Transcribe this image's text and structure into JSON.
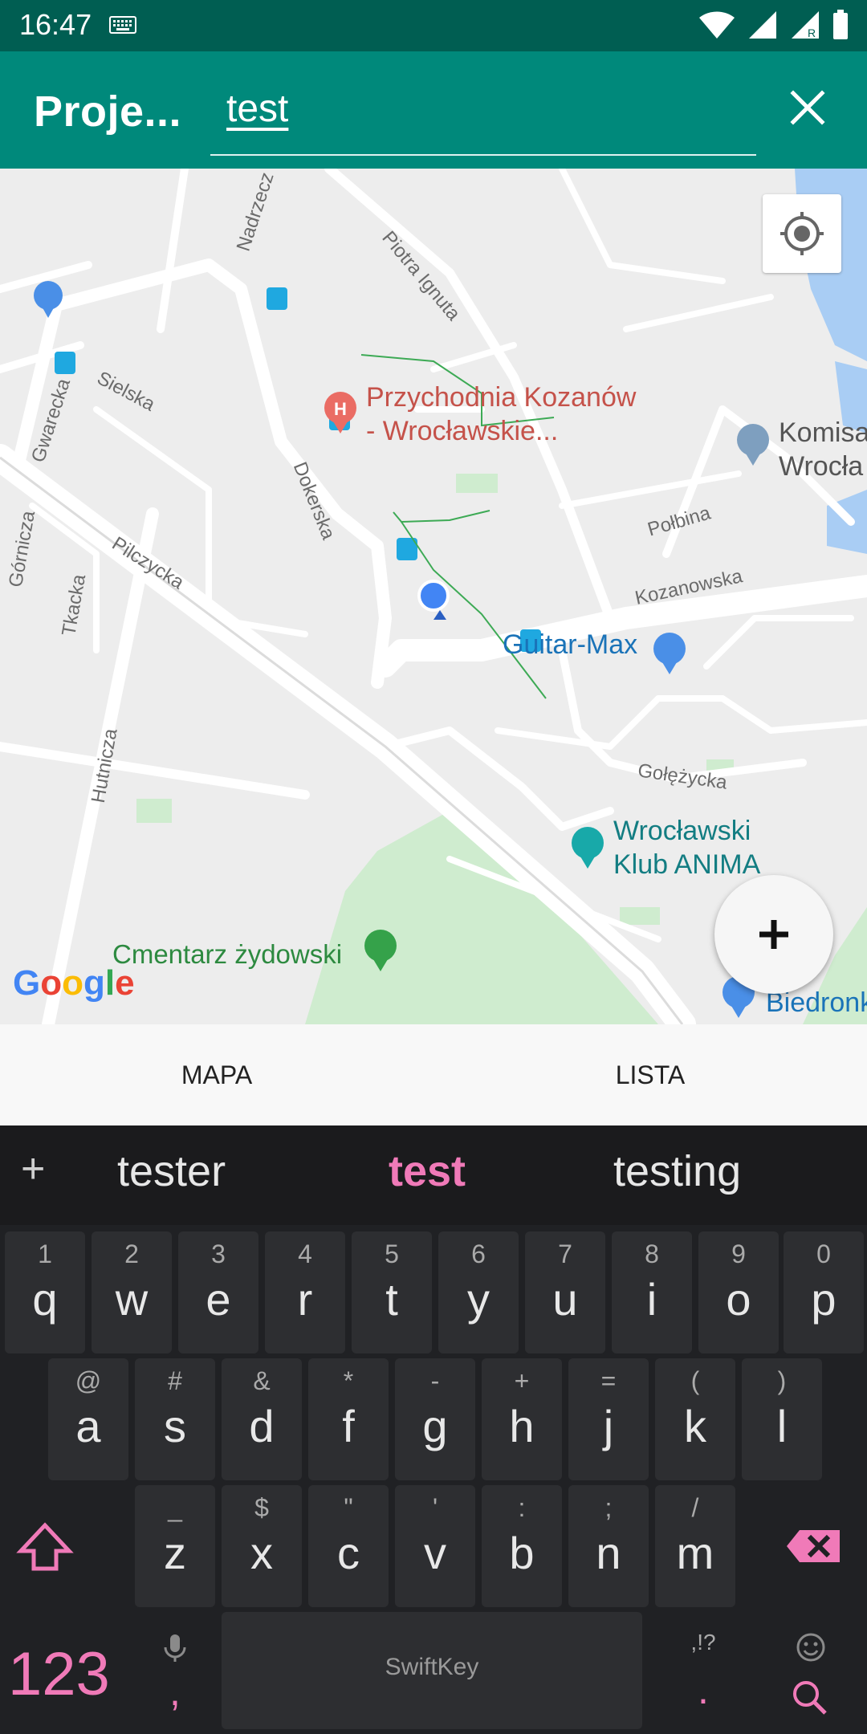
{
  "status_bar": {
    "time": "16:47"
  },
  "app_bar": {
    "title": "Proje...",
    "search_value": "test"
  },
  "map": {
    "poi": {
      "clinic": "Przychodnia Kozanów\n- Wrocławskie...",
      "clinic_line1": "Przychodnia Kozanów",
      "clinic_line2": "- Wrocławskie...",
      "komis_line1": "Komisa",
      "komis_line2": "Wrocła",
      "guitar": "Guitar-Max",
      "club_line1": "Wrocławski",
      "club_line2": "Klub ANIMA",
      "cemetery": "Cmentarz żydowski",
      "biedronka": "Biedronk"
    },
    "streets": [
      "Nadrzecz",
      "Piotra Ignuta",
      "Sielska",
      "Gwarecka",
      "Dokerska",
      "Połbina",
      "Kozanowska",
      "Górnicza",
      "Tkacka",
      "Pilczycka",
      "Hutnicza",
      "Gołężycka"
    ],
    "google": "Google"
  },
  "tabs": {
    "map": "MAPA",
    "list": "LISTA"
  },
  "keyboard": {
    "suggestions": [
      "tester",
      "test",
      "testing"
    ],
    "row1": [
      {
        "alt": "1",
        "key": "q"
      },
      {
        "alt": "2",
        "key": "w"
      },
      {
        "alt": "3",
        "key": "e"
      },
      {
        "alt": "4",
        "key": "r"
      },
      {
        "alt": "5",
        "key": "t"
      },
      {
        "alt": "6",
        "key": "y"
      },
      {
        "alt": "7",
        "key": "u"
      },
      {
        "alt": "8",
        "key": "i"
      },
      {
        "alt": "9",
        "key": "o"
      },
      {
        "alt": "0",
        "key": "p"
      }
    ],
    "row2": [
      {
        "alt": "@",
        "key": "a"
      },
      {
        "alt": "#",
        "key": "s"
      },
      {
        "alt": "&",
        "key": "d"
      },
      {
        "alt": "*",
        "key": "f"
      },
      {
        "alt": "-",
        "key": "g"
      },
      {
        "alt": "+",
        "key": "h"
      },
      {
        "alt": "=",
        "key": "j"
      },
      {
        "alt": "(",
        "key": "k"
      },
      {
        "alt": ")",
        "key": "l"
      }
    ],
    "row3": [
      {
        "alt": "_",
        "key": "z"
      },
      {
        "alt": "$",
        "key": "x"
      },
      {
        "alt": "\"",
        "key": "c"
      },
      {
        "alt": "'",
        "key": "v"
      },
      {
        "alt": ":",
        "key": "b"
      },
      {
        "alt": ";",
        "key": "n"
      },
      {
        "alt": "/",
        "key": "m"
      }
    ],
    "num_label": "123",
    "comma": ",",
    "space_brand": "SwiftKey",
    "punct_alt": ",!?",
    "period": "."
  }
}
